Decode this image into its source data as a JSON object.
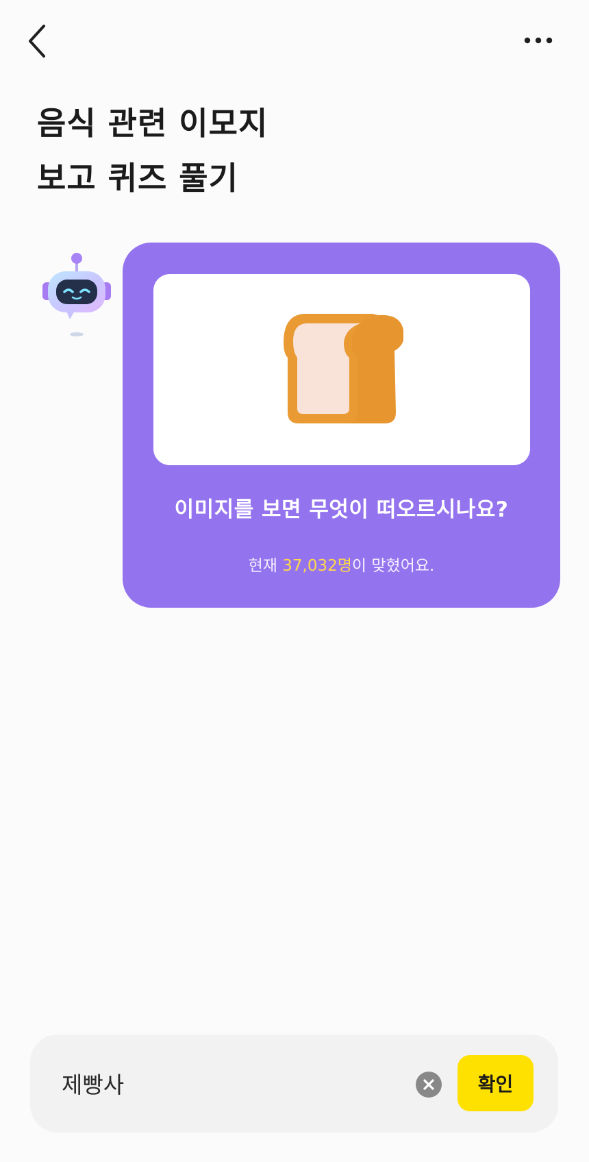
{
  "header": {
    "back_icon": "chevron-left-icon",
    "more_icon": "more-horizontal-icon"
  },
  "title": {
    "line1": "음식 관련 이모지",
    "line2": "보고 퀴즈 풀기"
  },
  "quiz": {
    "avatar_icon": "robot-avatar-icon",
    "image_icon": "bread-emoji",
    "question": "이미지를 보면 무엇이 떠오르시나요?",
    "stats_prefix": "현재 ",
    "stats_count": "37,032명",
    "stats_suffix": "이 맞혔어요."
  },
  "answer": {
    "value": "제빵사",
    "clear_icon": "clear-circle-icon",
    "confirm_label": "확인"
  },
  "colors": {
    "bubble": "#9473ee",
    "highlight": "#ffd84a",
    "confirm": "#ffe100",
    "bread_crust": "#e99a33",
    "bread_inside": "#f9e3d9"
  }
}
